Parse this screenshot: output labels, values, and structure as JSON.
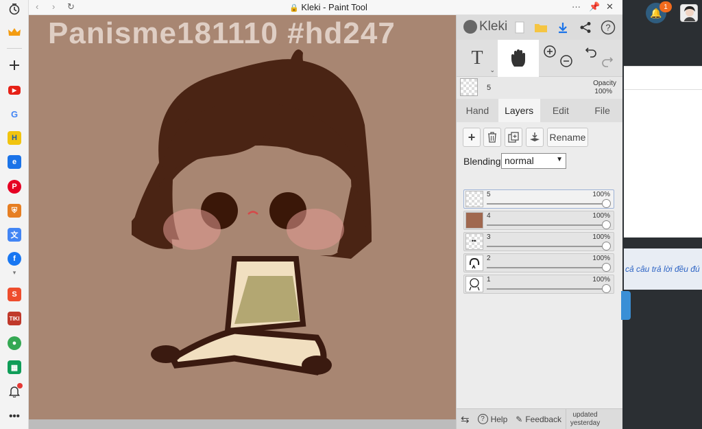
{
  "window": {
    "title": "Kleki - Paint Tool"
  },
  "canvas": {
    "overlay_title": "Panisme181110 #hd247",
    "background_color": "#a88672"
  },
  "kleki": {
    "logo_text": "Kleki",
    "tools": [
      "text-tool",
      "hand-tool",
      "zoom-in",
      "zoom-out",
      "undo",
      "redo"
    ],
    "text_tool_label": "T",
    "brush_size": "5",
    "opacity_label": "Opacity",
    "opacity_value": "100%",
    "tabs": [
      "Hand",
      "Layers",
      "Edit",
      "File"
    ],
    "active_tab": "Layers",
    "layer_buttons": {
      "rename": "Rename"
    },
    "blending_label": "Blending",
    "blending_value": "normal",
    "layers": [
      {
        "name": "5",
        "opacity": "100%",
        "selected": true
      },
      {
        "name": "4",
        "opacity": "100%",
        "selected": false
      },
      {
        "name": "3",
        "opacity": "100%",
        "selected": false
      },
      {
        "name": "2",
        "opacity": "100%",
        "selected": false
      },
      {
        "name": "1",
        "opacity": "100%",
        "selected": false
      }
    ],
    "footer": {
      "help": "Help",
      "feedback": "Feedback",
      "updated": "updated yesterday"
    }
  },
  "background_page": {
    "notification_count": "1",
    "partial_text": "cả câu trả lời đều đú"
  }
}
